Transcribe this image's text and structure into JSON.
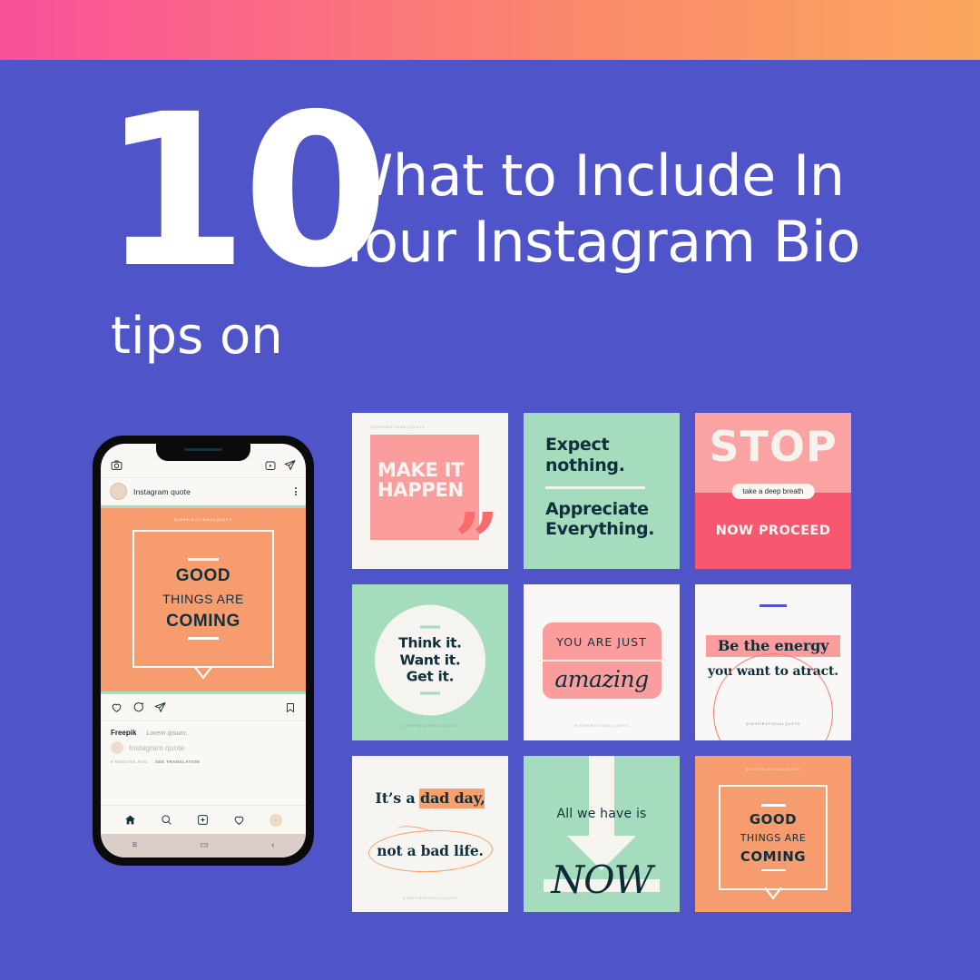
{
  "colors": {
    "background": "#4F55C8",
    "gradient_start": "#F9509A",
    "gradient_end": "#FBA75E",
    "mint": "#A6DCBE",
    "salmon": "#FB9D9D",
    "orange": "#F79C6E",
    "pink": "#F7576F",
    "offwhite": "#F7F5F2",
    "dark_teal": "#0E2F3B"
  },
  "headline": {
    "number": "10",
    "kicker": "tips on",
    "title_line1": "What to Include In",
    "title_line2": "Your Instagram Bio"
  },
  "phone": {
    "topbar": {
      "camera_icon": "camera-icon",
      "igtv_icon": "igtv-icon",
      "messenger_icon": "messenger-icon"
    },
    "post_header": {
      "username": "Instagram quote",
      "menu_icon": "more-options-icon"
    },
    "post_image": {
      "tag": "@INSPIRATIONALQUOTE",
      "line1": "GOOD",
      "line2": "THINGS ARE",
      "line3": "COMING"
    },
    "actions": {
      "like_icon": "heart-icon",
      "comment_icon": "comment-icon",
      "share_icon": "share-icon",
      "save_icon": "bookmark-icon"
    },
    "caption": {
      "brand": "Freepik",
      "lorem": "Lorem ipsum...",
      "username": "Instagram quote",
      "time": "9 MINUTES AGO",
      "translate": "SEE TRANSLATION"
    },
    "tabs": {
      "home_icon": "home-icon",
      "search_icon": "search-icon",
      "add_icon": "add-post-icon",
      "activity_icon": "heart-icon",
      "profile_icon": "profile-avatar"
    },
    "android_nav": {
      "recents": "≡",
      "home": "▭",
      "back": "‹"
    }
  },
  "grid": {
    "cards": [
      {
        "name": "make-it-happen",
        "tag": "@INSPIRATIONALQUOTE",
        "line1": "MAKE IT",
        "line2": "HAPPEN",
        "quote_glyph": "”"
      },
      {
        "name": "expect-nothing",
        "line1": "Expect",
        "line2": "nothing.",
        "line3": "Appreciate",
        "line4": "Everything."
      },
      {
        "name": "stop-breathe",
        "word": "STOP",
        "pill": "take a deep breath",
        "proceed": "NOW PROCEED"
      },
      {
        "name": "think-want-get",
        "line1": "Think it.",
        "line2": "Want it.",
        "line3": "Get it.",
        "tag": "@INSPIRATIONALQUOTE"
      },
      {
        "name": "you-are-just-amazing",
        "top": "YOU ARE JUST",
        "bottom": "amazing",
        "tag": "@INSPIRATIONALQUOTE"
      },
      {
        "name": "be-the-energy",
        "line1": "Be the energy",
        "line2": "you want to atract.",
        "tag": "@INSPIRATIONALQUOTE"
      },
      {
        "name": "dad-day",
        "line1_a": "It’s a ",
        "line1_b": "dad day,",
        "line2": "not a bad life.",
        "tag": "@INSPIRATIONALQUOTE"
      },
      {
        "name": "all-we-have-is-now",
        "top": "All we have is",
        "word": "NOW"
      },
      {
        "name": "good-things-coming",
        "tag": "@INSPIRATIONALQUOTE",
        "line1": "GOOD",
        "line2": "THINGS ARE",
        "line3": "COMING"
      }
    ]
  }
}
